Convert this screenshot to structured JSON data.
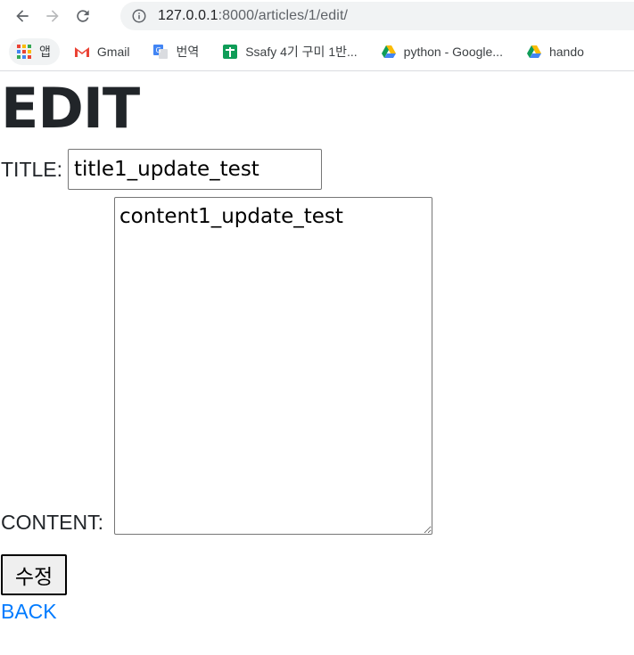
{
  "browser": {
    "url_host": "127.0.0.1",
    "url_rest": ":8000/articles/1/edit/",
    "bookmarks": [
      {
        "label": "앱",
        "icon": "apps-grid-icon"
      },
      {
        "label": "Gmail",
        "icon": "gmail-icon"
      },
      {
        "label": "번역",
        "icon": "translate-icon"
      },
      {
        "label": "Ssafy 4기 구미 1반...",
        "icon": "sheets-icon"
      },
      {
        "label": "python - Google...",
        "icon": "drive-icon"
      },
      {
        "label": "hando",
        "icon": "drive-icon"
      }
    ]
  },
  "page": {
    "heading": "EDIT",
    "title_label": "TITLE:",
    "title_value": "title1_update_test",
    "content_label": "CONTENT:",
    "content_value": "content1_update_test",
    "submit_label": "수정",
    "back_link": "BACK"
  },
  "colors": {
    "link": "#007bff",
    "text": "#212529"
  }
}
